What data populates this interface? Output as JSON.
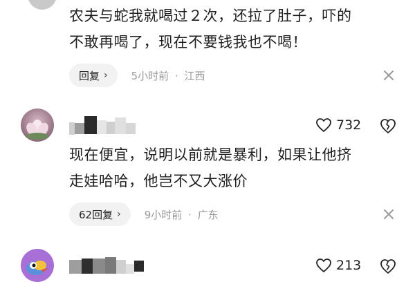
{
  "comments": [
    {
      "text_lines": [
        "农夫与蛇我就喝过２次，还拉了肚子，吓的",
        "不敢再喝了，现在不要钱我也不喝！"
      ],
      "reply_label": "回复",
      "time": "5小时前",
      "location": "江西"
    },
    {
      "like_count": "732",
      "text_lines": [
        "现在便宜，说明以前就是暴利，如果让他挤",
        "走娃哈哈，他岂不又大涨价"
      ],
      "reply_label": "62回复",
      "time": "9小时前",
      "location": "广东"
    },
    {
      "like_count": "213"
    }
  ],
  "icons": {
    "reply_chevron": "chevron-right-icon",
    "close": "close-icon",
    "like": "heart-icon",
    "dislike": "broken-heart-icon"
  },
  "meta_separator": "·",
  "chevron": "›"
}
